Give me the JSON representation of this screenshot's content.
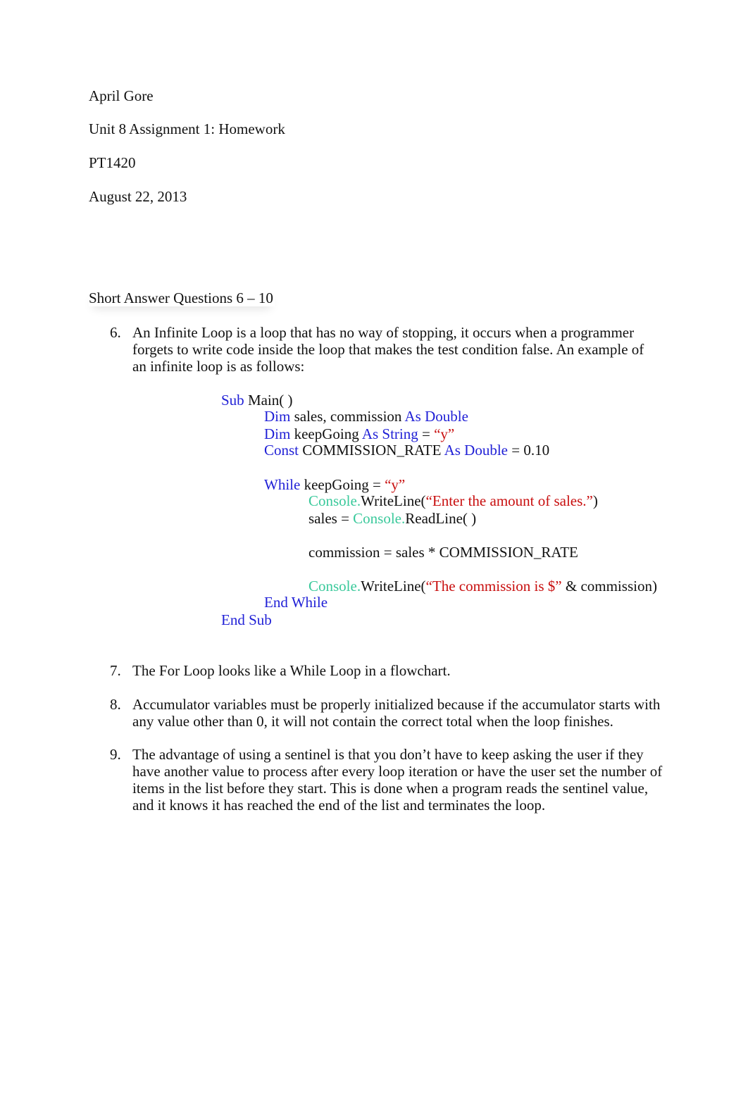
{
  "header": {
    "author": "April Gore",
    "assignment": "Unit 8 Assignment 1: Homework",
    "course": "PT1420",
    "date": "August 22, 2013"
  },
  "section": {
    "heading": "Short Answer Questions 6 – 10"
  },
  "questions": [
    {
      "number": "6.",
      "lines": [
        "An Infinite Loop is a loop that has no way of stopping, it occurs when a programmer",
        "forgets to write code inside the loop that makes the test condition false.  An example of",
        "an infinite loop is as follows:"
      ]
    },
    {
      "number": "7.",
      "lines": [
        "The For Loop looks like a While Loop in a flowchart."
      ]
    },
    {
      "number": "8.",
      "lines": [
        "Accumulator variables must be properly initialized because if the accumulator starts with",
        "any value other than 0, it will not contain the correct total when the loop finishes."
      ]
    },
    {
      "number": "9.",
      "lines": [
        "The advantage of using a sentinel is that you don’t have to keep asking the user if they",
        "have another value to process after every loop iteration or have the user set the number of",
        "items in the list before they start.  This is done when a program reads the sentinel value,",
        "and it knows it has reached the end of the list and terminates the loop."
      ]
    }
  ],
  "code": {
    "colors": {
      "keyword": "#1f1fd6",
      "class": "#3ac99b",
      "string": "#c80e0e",
      "plain": "#111111"
    },
    "lines": [
      {
        "indent": 0,
        "tokens": [
          {
            "t": "kw",
            "v": "Sub"
          },
          {
            "t": "plain",
            "v": " Main( )"
          }
        ]
      },
      {
        "indent": 1,
        "tokens": [
          {
            "t": "kw",
            "v": "Dim"
          },
          {
            "t": "plain",
            "v": " sales, commission "
          },
          {
            "t": "kw",
            "v": "As Double"
          }
        ]
      },
      {
        "indent": 1,
        "tokens": [
          {
            "t": "kw",
            "v": "Dim"
          },
          {
            "t": "plain",
            "v": " keepGoing "
          },
          {
            "t": "kw",
            "v": "As String"
          },
          {
            "t": "plain",
            "v": " = "
          },
          {
            "t": "str",
            "v": "“y”"
          }
        ]
      },
      {
        "indent": 1,
        "tokens": [
          {
            "t": "kw",
            "v": "Const"
          },
          {
            "t": "plain",
            "v": " COMMISSION_RATE "
          },
          {
            "t": "kw",
            "v": "As Double"
          },
          {
            "t": "plain",
            "v": " = 0.10"
          }
        ]
      },
      {
        "indent": 1,
        "tokens": [
          {
            "t": "kw",
            "v": "While"
          },
          {
            "t": "plain",
            "v": " keepGoing = "
          },
          {
            "t": "str",
            "v": "“y”"
          }
        ]
      },
      {
        "indent": 2,
        "tokens": [
          {
            "t": "cls",
            "v": "Console."
          },
          {
            "t": "plain",
            "v": "WriteLine("
          },
          {
            "t": "str",
            "v": "“Enter the amount of sales.”"
          },
          {
            "t": "plain",
            "v": ")"
          }
        ]
      },
      {
        "indent": 2,
        "tokens": [
          {
            "t": "plain",
            "v": "sales = "
          },
          {
            "t": "cls",
            "v": "Console."
          },
          {
            "t": "plain",
            "v": "ReadLine( )"
          }
        ]
      },
      {
        "indent": 2,
        "tokens": [
          {
            "t": "plain",
            "v": "commission = sales * COMMISSION_RATE"
          }
        ]
      },
      {
        "indent": 2,
        "tokens": [
          {
            "t": "cls",
            "v": "Console."
          },
          {
            "t": "plain",
            "v": "WriteLine("
          },
          {
            "t": "str",
            "v": "“The commission is $”"
          },
          {
            "t": "plain",
            "v": " & commission)"
          }
        ]
      },
      {
        "indent": 1,
        "tokens": [
          {
            "t": "kw",
            "v": "End While"
          }
        ]
      },
      {
        "indent": 0,
        "tokens": [
          {
            "t": "kw",
            "v": "End Sub"
          }
        ]
      }
    ]
  }
}
